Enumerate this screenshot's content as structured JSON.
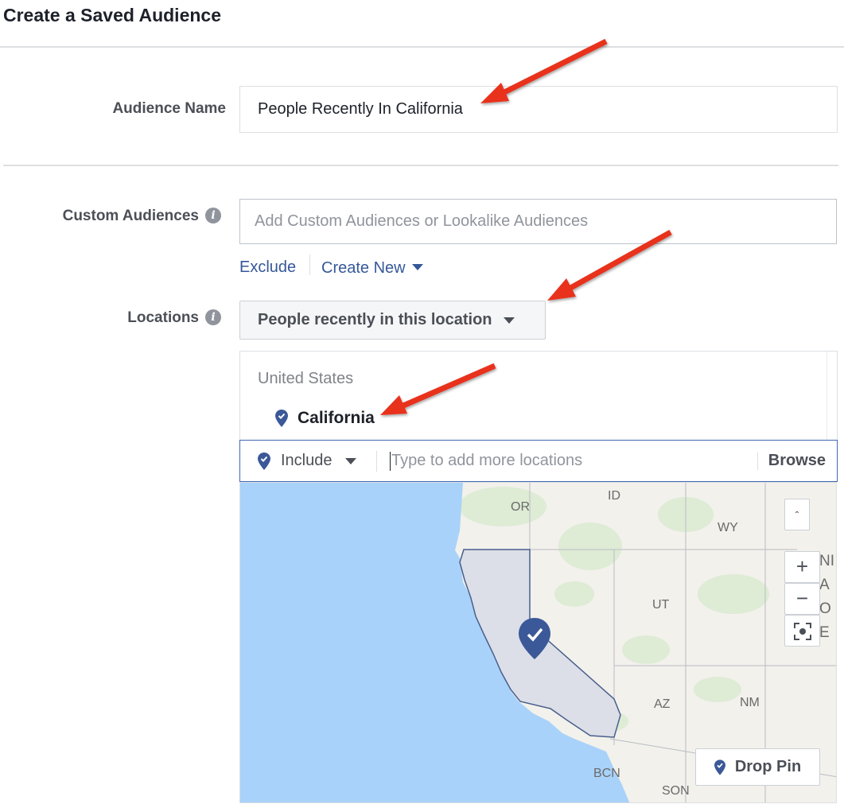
{
  "title": "Create a Saved Audience",
  "audience_name": {
    "label": "Audience Name",
    "value": "People Recently In California"
  },
  "custom_audiences": {
    "label": "Custom Audiences",
    "placeholder": "Add Custom Audiences or Lookalike Audiences",
    "exclude_link": "Exclude",
    "create_new_link": "Create New"
  },
  "locations": {
    "label": "Locations",
    "type_dropdown": "People recently in this location",
    "selected_country": "United States",
    "selected_region": "California",
    "include_label": "Include",
    "search_placeholder": "Type to add more locations",
    "browse_label": "Browse"
  },
  "map": {
    "labels": {
      "or": "OR",
      "id": "ID",
      "wy": "WY",
      "ut": "UT",
      "az": "AZ",
      "nm": "NM",
      "bcn": "BCN",
      "son": "SON"
    },
    "side_text": [
      "NI",
      "A",
      "O",
      "E"
    ],
    "zoom_in": "+",
    "zoom_out": "−",
    "drop_pin_label": "Drop Pin"
  },
  "colors": {
    "accent": "#4267b2",
    "link": "#365899",
    "annotation_arrow": "#e8301c",
    "water": "#a8d2f9",
    "selected_region_fill": "#dcdfe8"
  }
}
